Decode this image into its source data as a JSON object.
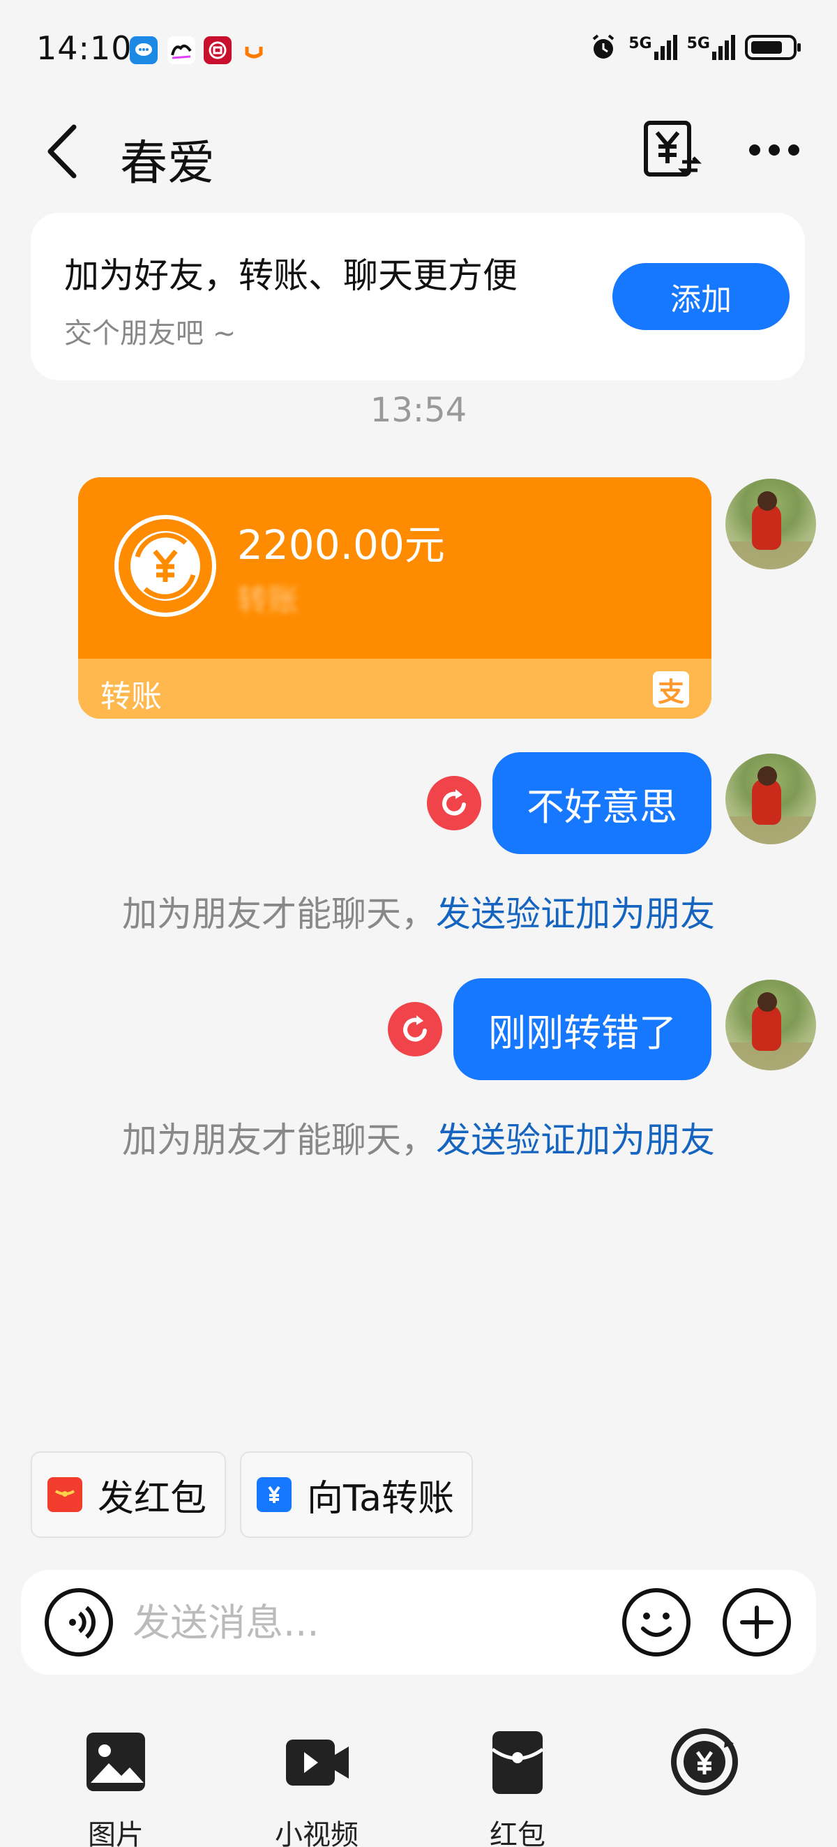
{
  "status_bar": {
    "time": "14:10",
    "signal_1": "5G",
    "signal_2": "5G"
  },
  "header": {
    "title": "春爱"
  },
  "friend_banner": {
    "title": "加为好友，转账、聊天更方便",
    "subtitle": "交个朋友吧 ~",
    "add_label": "添加"
  },
  "chat": {
    "timestamp": "13:54",
    "transfer": {
      "amount": "2200.00元",
      "note": "转账",
      "footer_label": "转账",
      "alipay_glyph": "支"
    },
    "messages": [
      {
        "text": "不好意思"
      },
      {
        "text": "刚刚转错了"
      }
    ],
    "system_notice": {
      "text": "加为朋友才能聊天，",
      "link": "发送验证加为朋友"
    }
  },
  "shortcuts": {
    "red_packet": "发红包",
    "transfer_to": "向Ta转账"
  },
  "composer": {
    "placeholder": "发送消息..."
  },
  "toolbar": {
    "items": [
      {
        "label": "图片"
      },
      {
        "label": "小视频"
      },
      {
        "label": "红包"
      }
    ]
  },
  "colors": {
    "accent": "#1677ff",
    "transfer_orange": "#ff8c00",
    "transfer_light": "#ffb84d",
    "error_red": "#f0434a",
    "link_blue": "#1565c0"
  }
}
